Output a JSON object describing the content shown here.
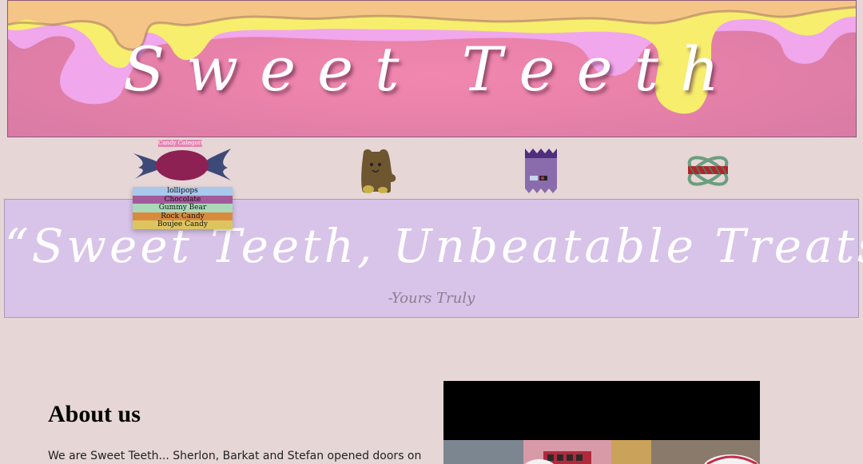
{
  "header": {
    "title": "Sweet Teeth",
    "colors": {
      "background": "#ea82aa",
      "drip_orange": "#f4c586",
      "drip_yellow": "#f7ee6e",
      "drip_pink": "#f0a7ec"
    }
  },
  "categories": {
    "label": "Candy Categories",
    "icons": [
      "wrapped-candy-icon",
      "gummy-bear-icon",
      "candy-bag-icon",
      "rock-candy-icon"
    ],
    "dropdown_items": [
      "lollipops",
      "Chocolate",
      "Gummy Bear",
      "Rock Candy",
      "Boujee Candy"
    ]
  },
  "quote": {
    "text": "“Sweet Teeth, Unbeatable Treats”",
    "signature": "-Yours Truly"
  },
  "about": {
    "heading": "About us",
    "text": "We are Sweet Teeth... Sherlon, Barkat and Stefan opened doors on"
  },
  "media": {
    "description_icon": "video-player"
  }
}
